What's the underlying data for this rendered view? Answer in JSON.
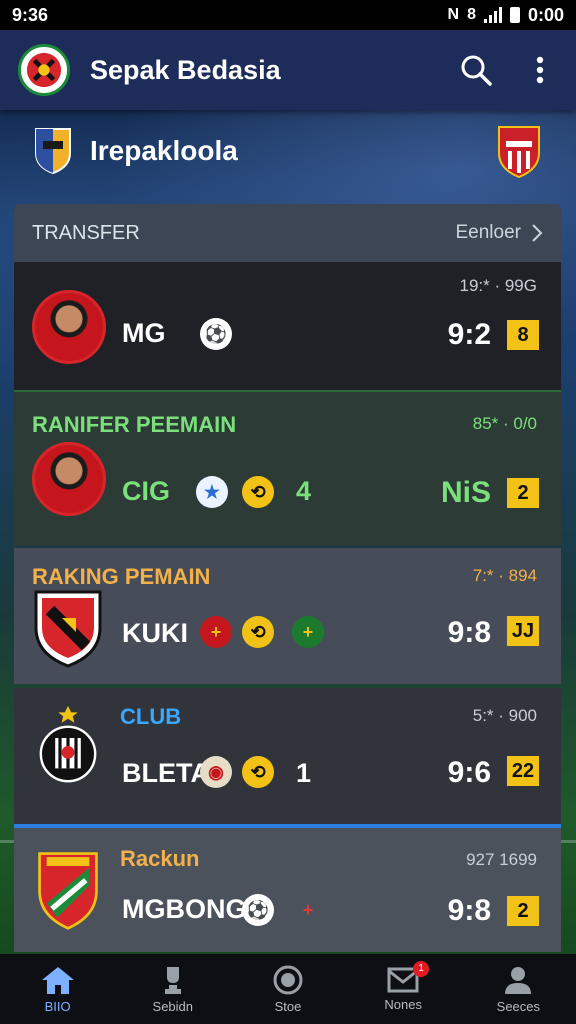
{
  "status_bar": {
    "time_left": "9:36",
    "time_right": "0:00"
  },
  "app_bar": {
    "title": "Sepak Bedasia",
    "logo_icon": "club-crest-icon",
    "search_icon": "search-icon",
    "menu_icon": "more-vert-icon"
  },
  "league": {
    "name": "Irepakloola"
  },
  "section": {
    "title": "TRANSFER",
    "more_label": "Eenloer"
  },
  "rows": [
    {
      "category": "",
      "name": "MG",
      "date": "19:* · 99G",
      "score": "9:2",
      "badge": "8"
    },
    {
      "category": "RANIFER PEEMAIN",
      "name": "CIG",
      "extra": "4",
      "date": "85* · 0/0",
      "score": "NiS",
      "badge": "2"
    },
    {
      "category": "RAKING PEMAIN",
      "name": "KUKI",
      "date": "7:* · 894",
      "score": "9:8",
      "badge": "JJ"
    },
    {
      "category": "CLUB",
      "name": "BLETA",
      "extra": "1",
      "date": "5:* · 900",
      "score": "9:6",
      "badge": "22"
    },
    {
      "category": "Rackun",
      "name": "MGBONG",
      "date": "927 1699",
      "score": "9:8",
      "badge": "2"
    }
  ],
  "nav": [
    {
      "label": "BIIO",
      "icon": "home-icon"
    },
    {
      "label": "Sebidn",
      "icon": "trophy-icon"
    },
    {
      "label": "Stoe",
      "icon": "target-icon"
    },
    {
      "label": "Nones",
      "icon": "mail-icon",
      "badge": "1"
    },
    {
      "label": "Seeces",
      "icon": "person-icon"
    }
  ],
  "colors": {
    "accent": "#f2c316",
    "green": "#7be07b",
    "orange": "#f2b14a",
    "blue": "#38a7ff"
  }
}
